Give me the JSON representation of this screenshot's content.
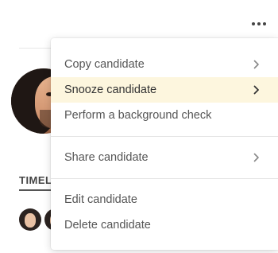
{
  "header": {
    "more_icon": "more-horizontal-icon"
  },
  "timeline": {
    "label": "TIMELI"
  },
  "menu": {
    "items": [
      {
        "label": "Copy candidate",
        "has_submenu": true
      },
      {
        "label": "Snooze candidate",
        "has_submenu": true,
        "highlighted": true
      },
      {
        "label": "Perform a background check",
        "has_submenu": false
      },
      {
        "label": "Share candidate",
        "has_submenu": true
      },
      {
        "label": "Edit candidate",
        "has_submenu": false
      },
      {
        "label": "Delete candidate",
        "has_submenu": false
      }
    ],
    "highlight_color": "#fdf6de",
    "chevron_icon": "chevron-right-icon"
  }
}
